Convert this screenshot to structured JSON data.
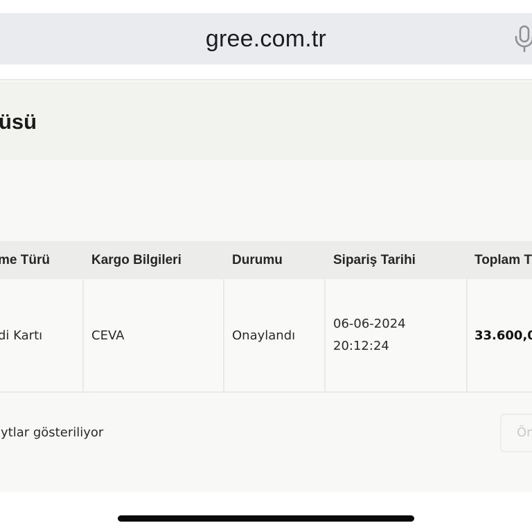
{
  "browser": {
    "url": "gree.com.tr",
    "mic_icon": "microphone-icon"
  },
  "page": {
    "title": "üsü"
  },
  "table": {
    "headers": [
      "me Türü",
      "Kargo Bilgileri",
      "Durumu",
      "Sipariş Tarihi",
      "Toplam T"
    ],
    "rows": [
      {
        "payment": "di Kartı",
        "cargo": "CEVA",
        "status": "Onaylandı",
        "date": "06-06-2024",
        "time": "20:12:24",
        "total": "33.600,0"
      }
    ]
  },
  "pagination": {
    "info": "ıytlar gösteriliyor",
    "prev_label": "Ön"
  }
}
